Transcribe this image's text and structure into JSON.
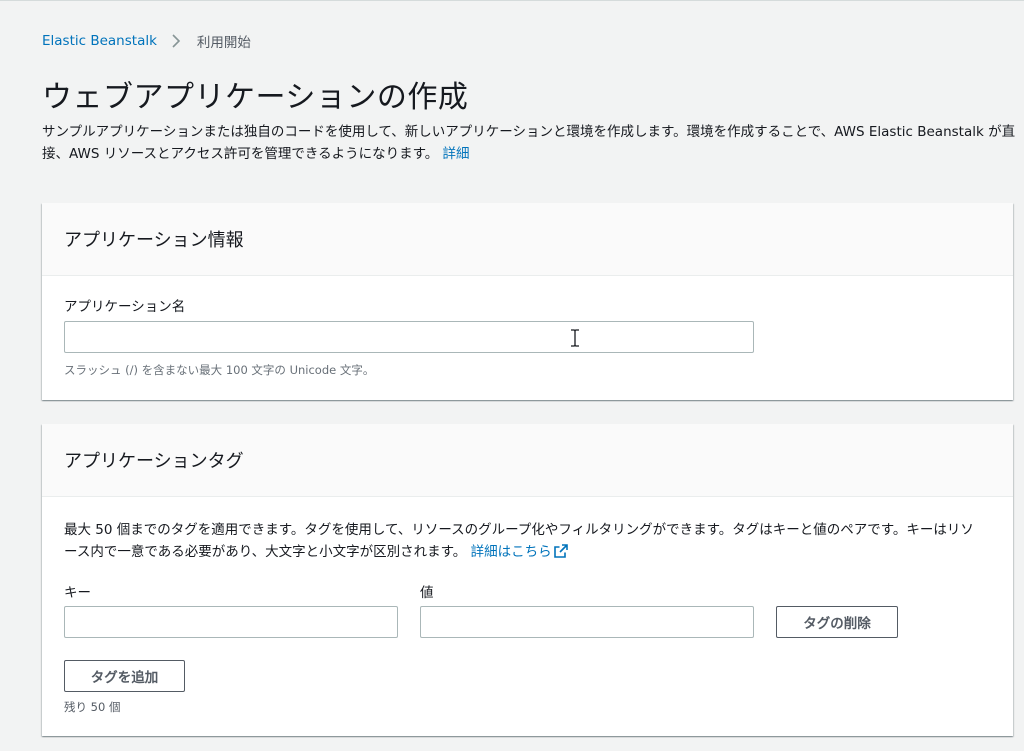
{
  "breadcrumb": {
    "root": "Elastic Beanstalk",
    "current": "利用開始"
  },
  "page": {
    "title": "ウェブアプリケーションの作成",
    "description": "サンプルアプリケーションまたは独自のコードを使用して、新しいアプリケーションと環境を作成します。環境を作成することで、AWS Elastic Beanstalk が直接、AWS リソースとアクセス許可を管理できるようになります。",
    "description_link": "詳細"
  },
  "app_info": {
    "title": "アプリケーション情報",
    "name_label": "アプリケーション名",
    "name_value": "",
    "name_hint": "スラッシュ (/) を含まない最大 100 文字の Unicode 文字。"
  },
  "app_tags": {
    "title": "アプリケーションタグ",
    "description": "最大 50 個までのタグを適用できます。タグを使用して、リソースのグループ化やフィルタリングができます。タグはキーと値のペアです。キーはリソース内で一意である必要があり、大文字と小文字が区別されます。",
    "description_link": "詳細はこちら",
    "key_label": "キー",
    "value_label": "値",
    "key_value": "",
    "value_value": "",
    "remove_label": "タグの削除",
    "add_label": "タグを追加",
    "remaining": "残り 50 個"
  },
  "icons": {
    "breadcrumb_separator": "chevron-right-icon",
    "external_link": "external-link-icon",
    "cursor": "text-cursor-icon"
  },
  "colors": {
    "link": "#0073bb",
    "background": "#f2f3f3",
    "text": "#16191f"
  }
}
